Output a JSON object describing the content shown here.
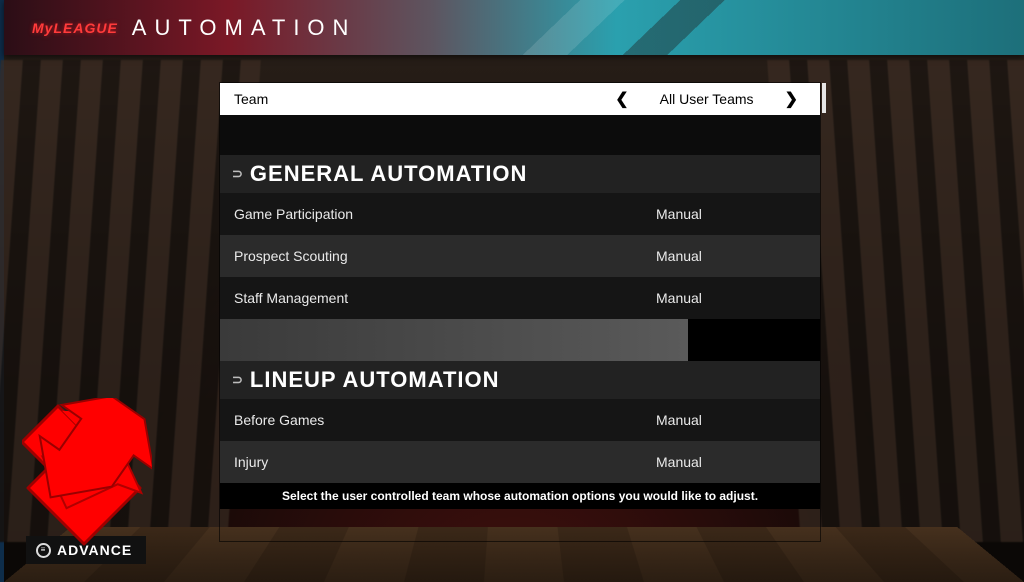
{
  "header": {
    "league_mark": "MyLEAGUE",
    "title": "AUTOMATION"
  },
  "selector": {
    "label": "Team",
    "value": "All User Teams"
  },
  "sections": {
    "general": {
      "title": "GENERAL AUTOMATION",
      "rows": {
        "game_participation": {
          "label": "Game Participation",
          "value": "Manual"
        },
        "prospect_scouting": {
          "label": "Prospect Scouting",
          "value": "Manual"
        },
        "staff_management": {
          "label": "Staff Management",
          "value": "Manual"
        }
      }
    },
    "lineup": {
      "title": "LINEUP AUTOMATION",
      "rows": {
        "before_games": {
          "label": "Before Games",
          "value": "Manual"
        },
        "injury": {
          "label": "Injury",
          "value": "Manual"
        }
      }
    }
  },
  "hint": "Select the user controlled team whose automation options you would like to adjust.",
  "footer": {
    "advance_label": "ADVANCE"
  }
}
